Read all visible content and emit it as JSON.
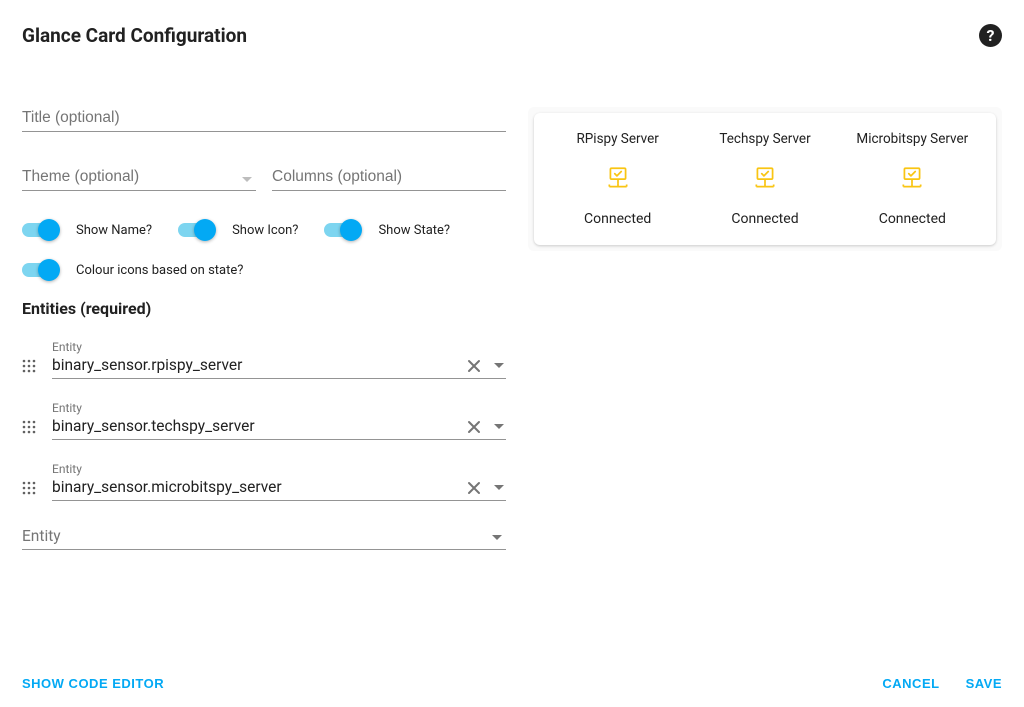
{
  "dialog": {
    "title": "Glance Card Configuration"
  },
  "fields": {
    "title_placeholder": "Title (optional)",
    "theme_placeholder": "Theme (optional)",
    "columns_placeholder": "Columns (optional)"
  },
  "toggles": {
    "show_name": "Show Name?",
    "show_icon": "Show Icon?",
    "show_state": "Show State?",
    "state_color": "Colour icons based on state?"
  },
  "entities": {
    "heading": "Entities (required)",
    "field_label": "Entity",
    "items": [
      {
        "value": "binary_sensor.rpispy_server"
      },
      {
        "value": "binary_sensor.techspy_server"
      },
      {
        "value": "binary_sensor.microbitspy_server"
      }
    ],
    "add_placeholder": "Entity"
  },
  "preview": [
    {
      "name": "RPispy Server",
      "state": "Connected"
    },
    {
      "name": "Techspy Server",
      "state": "Connected"
    },
    {
      "name": "Microbitspy Server",
      "state": "Connected"
    }
  ],
  "buttons": {
    "show_code": "SHOW CODE EDITOR",
    "cancel": "CANCEL",
    "save": "SAVE"
  },
  "colors": {
    "accent": "#03a9f4",
    "icon": "#f9c513"
  }
}
